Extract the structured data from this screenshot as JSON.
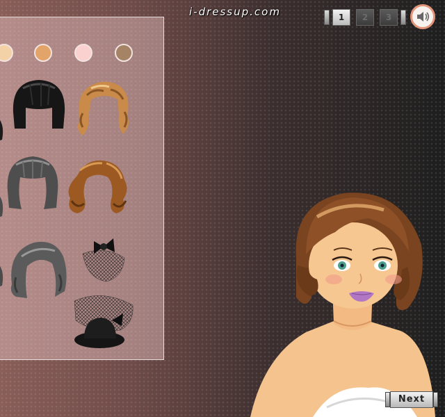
{
  "header": {
    "brand": "i-dressup.com"
  },
  "pager": {
    "pages": [
      "1",
      "2",
      "3"
    ],
    "active": "1"
  },
  "sound": {
    "icon": "speaker-icon"
  },
  "palette": {
    "swatches": [
      {
        "name": "swatch-light-peach",
        "color": "#f3d2a8"
      },
      {
        "name": "swatch-caramel",
        "color": "#e2a468"
      },
      {
        "name": "swatch-pink",
        "color": "#fbd1d0"
      },
      {
        "name": "swatch-taupe",
        "color": "#a58465"
      }
    ]
  },
  "items": [
    "black-blunt-bob-hair",
    "golden-curly-hair",
    "gray-bangs-bob-hair",
    "brown-curled-hair",
    "gray-side-part-hair",
    "black-bow-veil-hat",
    "black-pillbox-veil-hat"
  ],
  "navigation": {
    "next_label": "Next"
  }
}
